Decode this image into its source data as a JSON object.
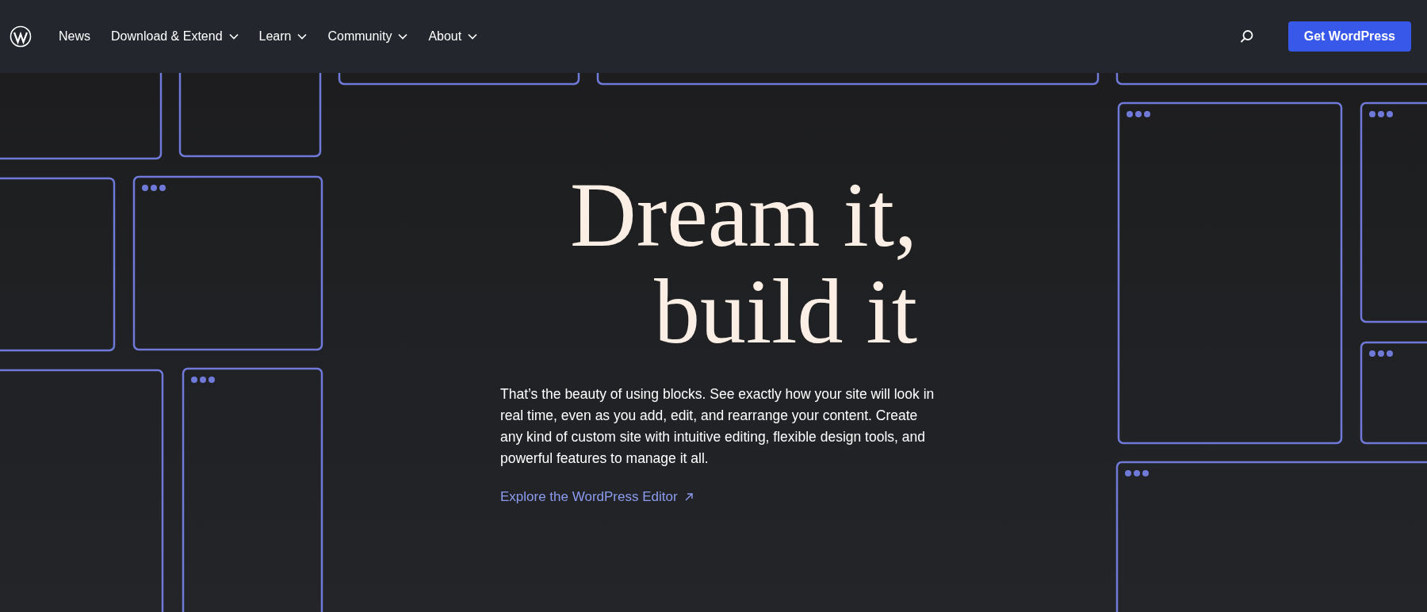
{
  "nav": {
    "items": [
      {
        "label": "News",
        "has_dropdown": false
      },
      {
        "label": "Download & Extend",
        "has_dropdown": true
      },
      {
        "label": "Learn",
        "has_dropdown": true
      },
      {
        "label": "Community",
        "has_dropdown": true
      },
      {
        "label": "About",
        "has_dropdown": true
      }
    ],
    "cta": "Get WordPress"
  },
  "hero": {
    "headline_lines": [
      "Dream it,",
      "build it"
    ],
    "body": "That’s the beauty of using blocks. See exactly how your site will look in real time, even as you add, edit, and rearrange your content. Create any kind of custom site with intuitive editing, flexible design tools, and powerful features to manage it all.",
    "link": "Explore the WordPress Editor"
  }
}
